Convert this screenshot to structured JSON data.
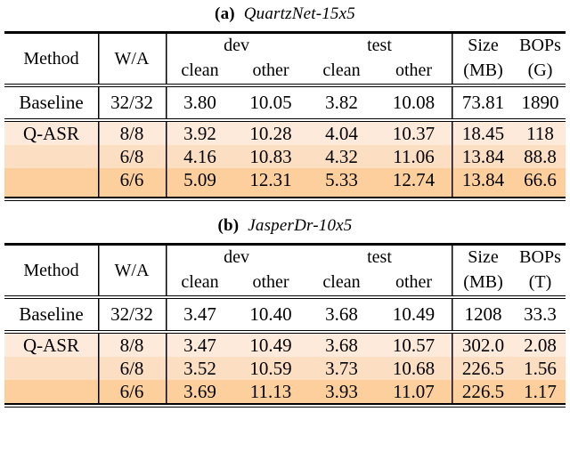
{
  "figure": {
    "tables": [
      {
        "caption_tag": "(a)",
        "caption_text": "QuartzNet-15x5",
        "columns": {
          "method": "Method",
          "wa": "W/A",
          "group_dev": "dev",
          "group_test": "test",
          "dev_clean": "clean",
          "dev_other": "other",
          "test_clean": "clean",
          "test_other": "other",
          "size_line1": "Size",
          "size_line2": "(MB)",
          "bops_line1": "BOPs",
          "bops_line2": "(G)"
        },
        "baseline": {
          "method": "Baseline",
          "wa": "32/32",
          "dev_clean": "3.80",
          "dev_other": "10.05",
          "test_clean": "3.82",
          "test_other": "10.08",
          "size": "73.81",
          "bops": "1890"
        },
        "qasr_label": "Q-ASR",
        "qasr_rows": [
          {
            "method": "Q-ASR",
            "wa": "8/8",
            "dev_clean": "3.92",
            "dev_other": "10.28",
            "test_clean": "4.04",
            "test_other": "10.37",
            "size": "18.45",
            "bops": "118",
            "highlight": "#fdeadb"
          },
          {
            "method": "",
            "wa": "6/8",
            "dev_clean": "4.16",
            "dev_other": "10.83",
            "test_clean": "4.32",
            "test_other": "11.06",
            "size": "13.84",
            "bops": "88.8",
            "highlight": "#fcdec3"
          },
          {
            "method": "",
            "wa": "6/6",
            "dev_clean": "5.09",
            "dev_other": "12.31",
            "test_clean": "5.33",
            "test_other": "12.74",
            "size": "13.84",
            "bops": "66.6",
            "highlight": "#fccf9c"
          }
        ]
      },
      {
        "caption_tag": "(b)",
        "caption_text": "JasperDr-10x5",
        "columns": {
          "method": "Method",
          "wa": "W/A",
          "group_dev": "dev",
          "group_test": "test",
          "dev_clean": "clean",
          "dev_other": "other",
          "test_clean": "clean",
          "test_other": "other",
          "size_line1": "Size",
          "size_line2": "(MB)",
          "bops_line1": "BOPs",
          "bops_line2": "(T)"
        },
        "baseline": {
          "method": "Baseline",
          "wa": "32/32",
          "dev_clean": "3.47",
          "dev_other": "10.40",
          "test_clean": "3.68",
          "test_other": "10.49",
          "size": "1208",
          "bops": "33.3"
        },
        "qasr_label": "Q-ASR",
        "qasr_rows": [
          {
            "method": "Q-ASR",
            "wa": "8/8",
            "dev_clean": "3.47",
            "dev_other": "10.49",
            "test_clean": "3.68",
            "test_other": "10.57",
            "size": "302.0",
            "bops": "2.08",
            "highlight": "#fdeadb"
          },
          {
            "method": "",
            "wa": "6/8",
            "dev_clean": "3.52",
            "dev_other": "10.59",
            "test_clean": "3.73",
            "test_other": "10.68",
            "size": "226.5",
            "bops": "1.56",
            "highlight": "#fcdec3"
          },
          {
            "method": "",
            "wa": "6/6",
            "dev_clean": "3.69",
            "dev_other": "11.13",
            "test_clean": "3.93",
            "test_other": "11.07",
            "size": "226.5",
            "bops": "1.17",
            "highlight": "#fccf9c"
          }
        ]
      }
    ]
  }
}
